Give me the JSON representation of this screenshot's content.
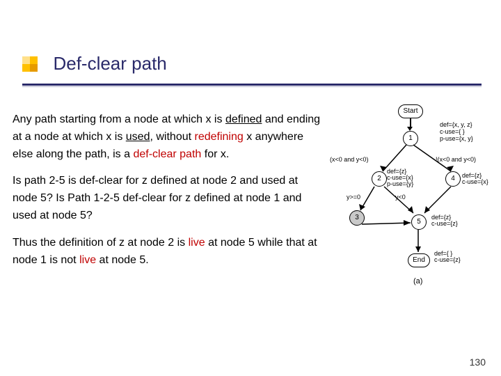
{
  "title": "Def-clear path",
  "para1": {
    "a": "Any path starting from a node at which x is ",
    "defined": "defined",
    "b": " and ending at a node at which x is ",
    "used": "used",
    "c": ", without ",
    "redef": "redefining",
    "d": " x anywhere else along the path, is a ",
    "dcp": "def-clear path",
    "e": " for x."
  },
  "para2": "Is path 2-5 is def-clear for z defined at node 2 and used at node 5? Is Path 1-2-5 def-clear for z defined at node 1 and used at node 5?",
  "para3": {
    "a": "Thus the definition of z at node 2 is ",
    "live1": "live",
    "b": " at node 5 while that at node 1 is not ",
    "live2": "live",
    "c": " at node 5."
  },
  "diagram": {
    "start": "Start",
    "end": "End",
    "n1": "1",
    "n2": "2",
    "n3": "3",
    "n4": "4",
    "n5": "5",
    "ann1": "def={x, y, z}\nc-use={ }\np-use={x, y}",
    "cond_left": "(x<0 and y<0)",
    "cond_right": "!(x<0 and y<0)",
    "ann2": "def={z}\nc-use={x}\np-use={y}",
    "ann4": "def={z}\nc-use={x}",
    "edge23": "y>=0",
    "edge25": "y<0",
    "ann5": "def={z}\nc-use={z}",
    "annEnd": "def={ }\nc-use={z}",
    "caption": "(a)"
  },
  "page_number": "130"
}
